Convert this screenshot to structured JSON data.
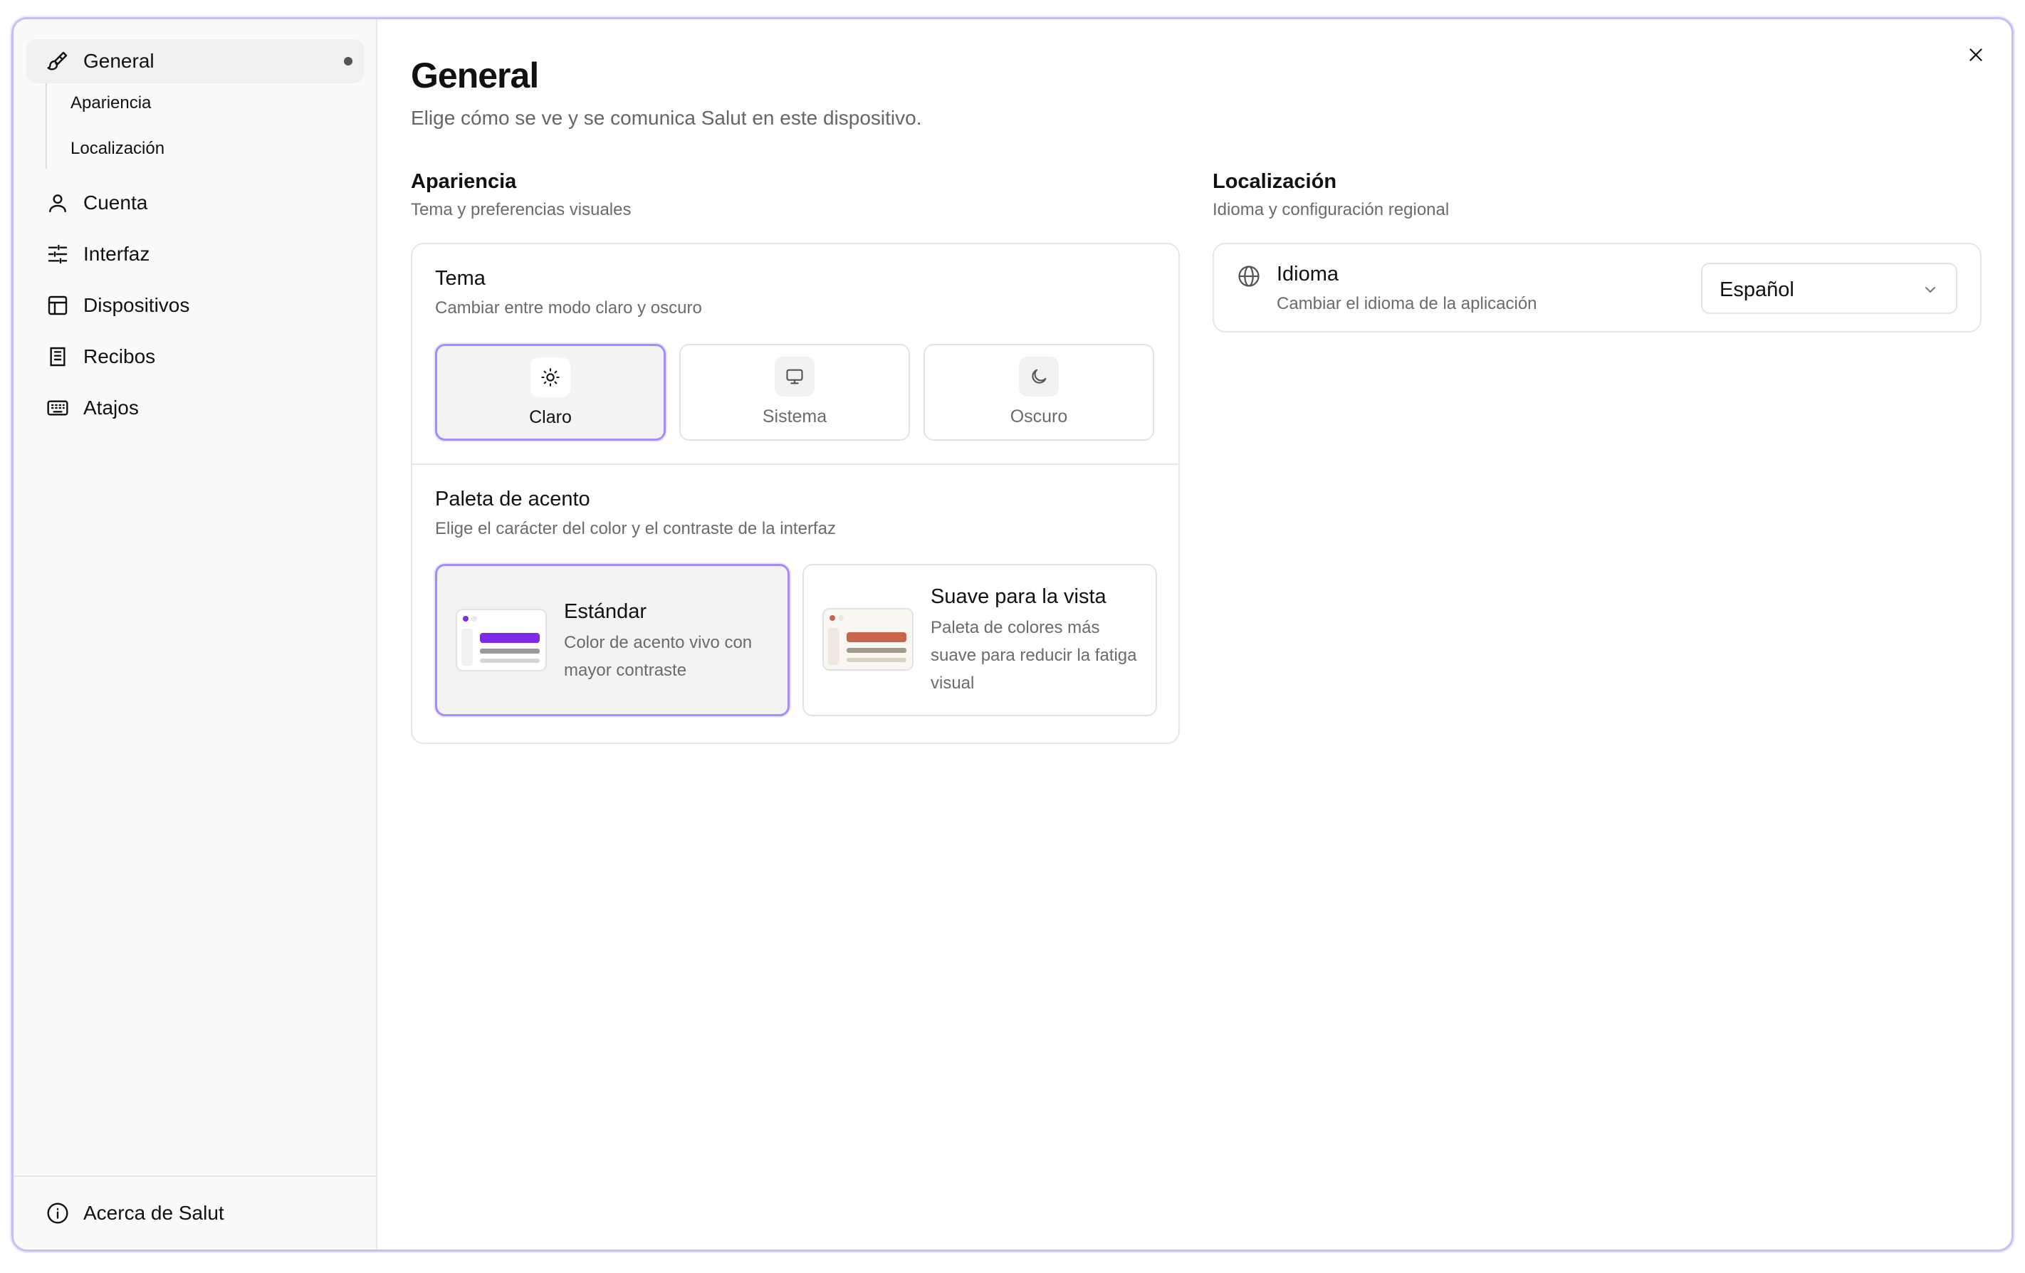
{
  "sidebar": {
    "items": [
      {
        "label": "General",
        "icon": "brush-icon"
      },
      {
        "label": "Cuenta",
        "icon": "user-icon"
      },
      {
        "label": "Interfaz",
        "icon": "sliders-icon"
      },
      {
        "label": "Dispositivos",
        "icon": "layout-icon"
      },
      {
        "label": "Recibos",
        "icon": "receipt-icon"
      },
      {
        "label": "Atajos",
        "icon": "keyboard-icon"
      }
    ],
    "subitems": [
      "Apariencia",
      "Localización"
    ],
    "footer": {
      "label": "Acerca de Salut",
      "icon": "info-icon"
    }
  },
  "main": {
    "title": "General",
    "subtitle": "Elige cómo se ve y se comunica Salut en este dispositivo.",
    "appearance": {
      "title": "Apariencia",
      "subtitle": "Tema y preferencias visuales",
      "theme": {
        "title": "Tema",
        "subtitle": "Cambiar entre modo claro y oscuro",
        "options": [
          {
            "label": "Claro",
            "icon": "sun-icon",
            "selected": true
          },
          {
            "label": "Sistema",
            "icon": "monitor-icon",
            "selected": false
          },
          {
            "label": "Oscuro",
            "icon": "moon-icon",
            "selected": false
          }
        ]
      },
      "palette": {
        "title": "Paleta de acento",
        "subtitle": "Elige el carácter del color y el contraste de la interfaz",
        "options": [
          {
            "title": "Estándar",
            "desc": "Color de acento vivo con mayor contraste",
            "accent": "#7c2ae8",
            "selected": true
          },
          {
            "title": "Suave para la vista",
            "desc": "Paleta de colores más suave para reducir la fatiga visual",
            "accent": "#c9654a",
            "selected": false
          }
        ]
      }
    },
    "localization": {
      "title": "Localización",
      "subtitle": "Idioma y configuración regional",
      "language": {
        "title": "Idioma",
        "subtitle": "Cambiar el idioma de la aplicación",
        "value": "Español",
        "icon": "globe-icon"
      }
    }
  },
  "colors": {
    "selection_border": "#a78bfa",
    "window_border": "#c9bdf5"
  }
}
